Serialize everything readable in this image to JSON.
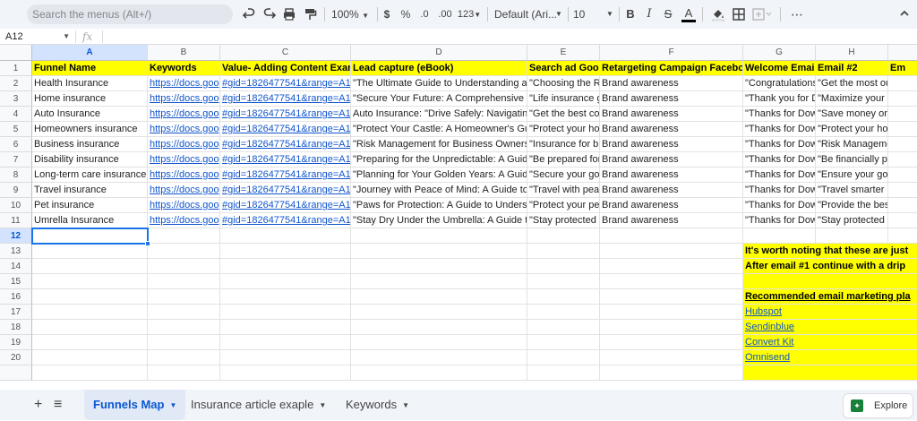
{
  "toolbar": {
    "search_placeholder": "Search the menus (Alt+/)",
    "zoom": "100%",
    "currency": "$",
    "percent": "%",
    "decrease_decimal": ".0",
    "increase_decimal": ".00",
    "number_format": "123",
    "font": "Default (Ari...",
    "font_size": "10",
    "bold": "B",
    "italic": "I",
    "strikethrough": "S",
    "text_color": "A",
    "more": "⋯"
  },
  "formula_bar": {
    "cell_ref": "A12",
    "fx": "fx",
    "value": ""
  },
  "columns": [
    "A",
    "B",
    "C",
    "D",
    "E",
    "F",
    "G",
    "H",
    ""
  ],
  "rows": [
    "1",
    "2",
    "3",
    "4",
    "5",
    "6",
    "7",
    "8",
    "9",
    "10",
    "11",
    "12",
    "13",
    "14",
    "15",
    "16",
    "17",
    "18",
    "19",
    "20",
    ""
  ],
  "header_row": [
    "Funnel Name",
    "Keywords",
    "Value- Adding Content Exam",
    "Lead capture (eBook)",
    "Search ad Goog",
    "Retargeting Campaign Faceboo",
    "Welcome Email",
    "Email #2",
    "Em"
  ],
  "data_rows": [
    [
      "Health Insurance",
      "https://docs.goog",
      "#gid=1826477541&range=A1",
      "\"The Ultimate Guide to Understanding and",
      "\"Choosing the Rig",
      "Brand awareness",
      "\"Congratulations",
      "\"Get the most out of"
    ],
    [
      "Home insurance",
      "https://docs.goog",
      "#gid=1826477541&range=A1",
      "\"Secure Your Future: A Comprehensive G",
      "\"Life insurance gu",
      "Brand awareness",
      "\"Thank you for Do",
      "\"Maximize your Life i"
    ],
    [
      "Auto Insurance",
      "https://docs.goog",
      "#gid=1826477541&range=A1",
      "Auto Insurance: \"Drive Safely: Navigating t",
      "\"Get the best cov",
      "Brand awareness",
      "\"Thanks for Down",
      "\"Save money on your"
    ],
    [
      "Homeowners insurance",
      "https://docs.goog",
      "#gid=1826477541&range=A1",
      "\"Protect Your Castle: A Homeowner's Gui",
      "\"Protect your hon",
      "Brand awareness",
      "\"Thanks for Down",
      "\"Protect your home a"
    ],
    [
      "Business insurance",
      "https://docs.goog",
      "#gid=1826477541&range=A1",
      "\"Risk Management for Business Owners: ",
      "\"Insurance for bu",
      "Brand awareness",
      "\"Thanks for Down",
      "\"Risk Management m"
    ],
    [
      "Disability insurance",
      "https://docs.goog",
      "#gid=1826477541&range=A1",
      "\"Preparing for the Unpredictable: A Guide",
      "\"Be prepared for ",
      "Brand awareness",
      "\"Thanks for Down",
      "\"Be financially prepar"
    ],
    [
      "Long-term care insurance",
      "https://docs.goog",
      "#gid=1826477541&range=A1",
      "\"Planning for Your Golden Years: A Guide ",
      "\"Secure your gol",
      "Brand awareness",
      "\"Thanks for Down",
      "\"Ensure your golden "
    ],
    [
      "Travel insurance",
      "https://docs.goog",
      "#gid=1826477541&range=A1",
      "\"Journey with Peace of Mind: A Guide to ",
      "\"Travel with peac",
      "Brand awareness",
      "\"Thanks for Down",
      "\"Travel smarter and s"
    ],
    [
      "Pet insurance",
      "https://docs.goog",
      "#gid=1826477541&range=A1",
      "\"Paws for Protection: A Guide to Understa",
      "\"Protect your pet",
      "Brand awareness",
      "\"Thanks for Down",
      "\"Provide the best car"
    ],
    [
      "Umrella Insurance",
      "https://docs.goog",
      "#gid=1826477541&range=A1",
      "\"Stay Dry Under the Umbrella: A Guide to ",
      "\"Stay protected u",
      "Brand awareness",
      "\"Thanks for Down",
      "\"Stay protected in an"
    ]
  ],
  "notes": {
    "note1": "It's worth noting that these are just",
    "note2": "After email #1 continue with a drip",
    "platforms_title": "Recommended email marketing pla",
    "platforms": [
      "Hubspot",
      "Sendinblue",
      "Convert Kit",
      "Omnisend"
    ]
  },
  "sheets": {
    "add": "+",
    "list": "≡",
    "tabs": [
      "Funnels Map",
      "Insurance article exaple",
      "Keywords"
    ],
    "active_index": 0,
    "explore": "Explore"
  },
  "colors": {
    "header_fill": "#ffff00",
    "link": "#1155cc",
    "selection": "#1a73e8",
    "explore_icon": "#188038"
  }
}
